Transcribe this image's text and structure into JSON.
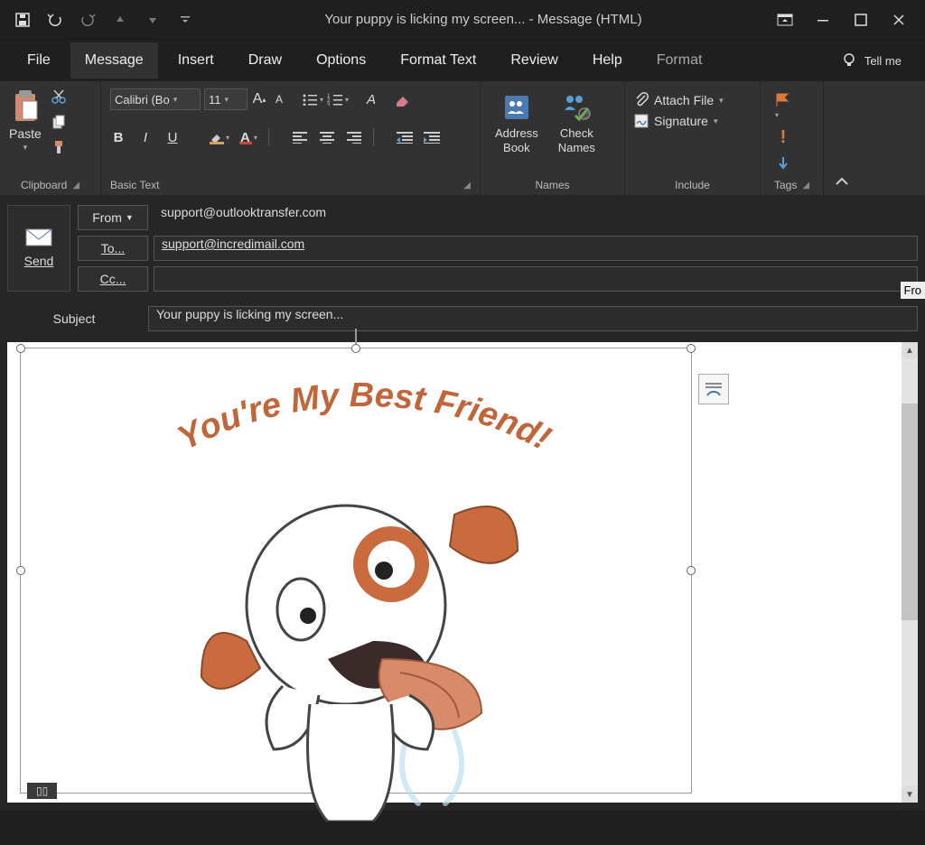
{
  "title": "Your puppy is licking my screen...  -  Message (HTML)",
  "menu": {
    "file": "File",
    "message": "Message",
    "insert": "Insert",
    "draw": "Draw",
    "options": "Options",
    "formatText": "Format Text",
    "review": "Review",
    "help": "Help",
    "format": "Format",
    "tellme": "Tell me"
  },
  "ribbon": {
    "paste": "Paste",
    "clipboard": "Clipboard",
    "fontName": "Calibri (Bo",
    "fontSize": "11",
    "basicText": "Basic Text",
    "addressBook": "Address\nBook",
    "checkNames": "Check\nNames",
    "names": "Names",
    "attachFile": "Attach File",
    "signature": "Signature",
    "include": "Include",
    "tags": "Tags"
  },
  "compose": {
    "fromLabel": "From",
    "fromValue": "support@outlooktransfer.com",
    "toLabel": "To...",
    "toValue": "support@incredimail.com",
    "ccLabel": "Cc...",
    "ccValue": "",
    "subjectLabel": "Subject",
    "subjectValue": "Your puppy is licking my screen...",
    "send": "Send",
    "fromTag": "Fro"
  },
  "bodyArt": {
    "text": "You're My Best Friend!"
  }
}
